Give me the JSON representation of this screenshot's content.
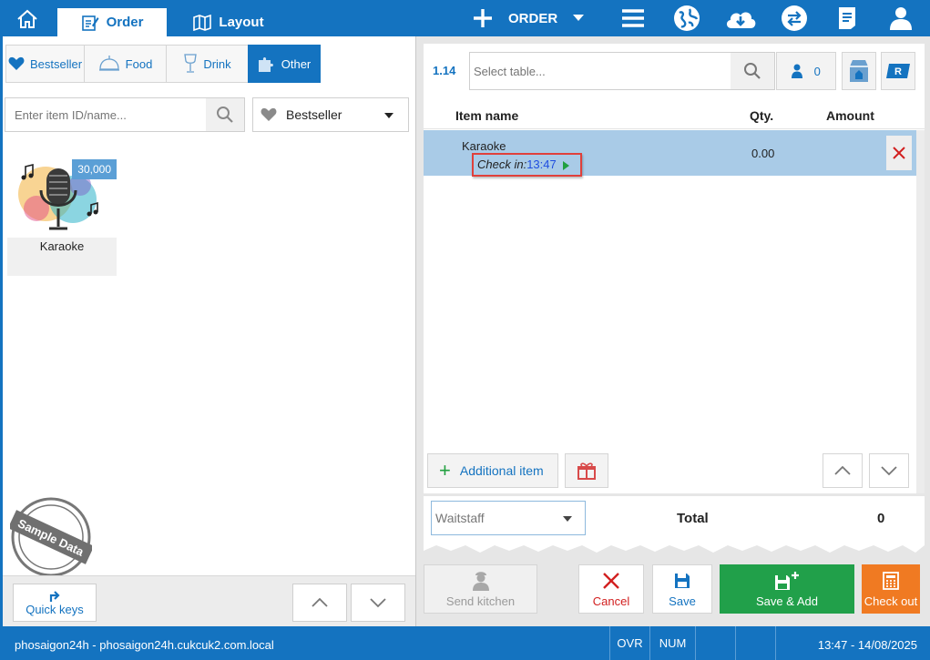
{
  "tabs": {
    "order": "Order",
    "layout": "Layout"
  },
  "topbar": {
    "order_label": "ORDER"
  },
  "categories": [
    {
      "label": "Bestseller",
      "icon": "heart-icon"
    },
    {
      "label": "Food",
      "icon": "cloche-icon"
    },
    {
      "label": "Drink",
      "icon": "glass-icon"
    },
    {
      "label": "Other",
      "icon": "puzzle-icon",
      "active": true
    }
  ],
  "search": {
    "placeholder": "Enter item ID/name...",
    "value": ""
  },
  "filter": {
    "selected": "Bestseller"
  },
  "items": [
    {
      "name": "Karaoke",
      "price": "30,000"
    }
  ],
  "stamp": "Sample Data",
  "left_bottom": {
    "quick_keys": "Quick keys"
  },
  "order": {
    "table_code": "1.14",
    "table_placeholder": "Select table...",
    "table_value": "",
    "guest_count": "0",
    "columns": {
      "item_name": "Item name",
      "qty": "Qty.",
      "amount": "Amount"
    },
    "rows": [
      {
        "name": "Karaoke",
        "checkin_label": "Check in:",
        "checkin_time": "13:47",
        "qty": "0.00"
      }
    ],
    "additional_item": "Additional item",
    "waitstaff_placeholder": "Waitstaff",
    "total_label": "Total",
    "total_value": "0"
  },
  "actions": {
    "send_kitchen": "Send kitchen",
    "cancel": "Cancel",
    "save": "Save",
    "save_add": "Save & Add",
    "check_out": "Check out"
  },
  "status": {
    "host": "phosaigon24h - phosaigon24h.cukcuk2.com.local",
    "ovr": "OVR",
    "num": "NUM",
    "datetime": "13:47 - 14/08/2025"
  },
  "colors": {
    "primary": "#1473c0",
    "success": "#21a04a",
    "warning": "#f07a22",
    "danger": "#d22020",
    "row_selected": "#a9cbe7"
  }
}
